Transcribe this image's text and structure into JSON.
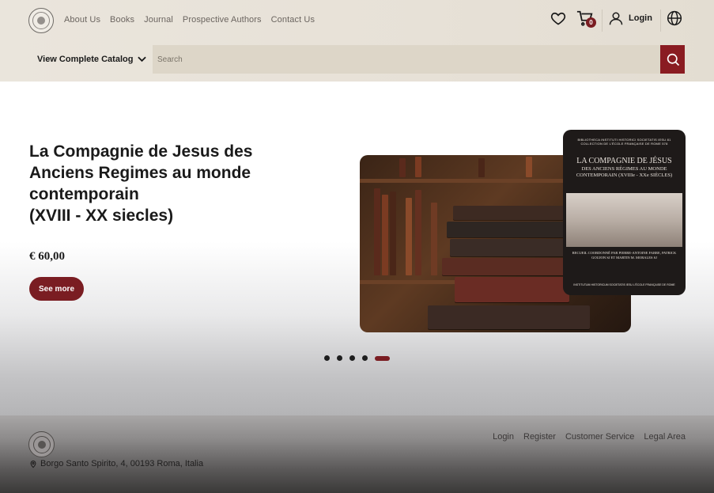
{
  "header": {
    "nav": [
      "About Us",
      "Books",
      "Journal",
      "Prospective Authors",
      "Contact Us"
    ],
    "cart_count": "0",
    "login_label": "Login",
    "catalog_label": "View Complete Catalog",
    "search_placeholder": "Search"
  },
  "hero": {
    "title": "La Compagnie de Jesus des Anciens Regimes au monde contemporain\n(XVIII - XX siecles)",
    "price": "€ 60,00",
    "button_label": "See more",
    "slides": 5,
    "active_slide": 5
  },
  "book_cover": {
    "top_text": "BIBLIOTHECA INSTITUTI HISTORICI SOCIETATIS IESU 81 COLLECTION DE L'ÉCOLE FRANÇAISE DE ROME 578",
    "title": "LA COMPAGNIE DE JÉSUS",
    "subtitle": "DES ANCIENS RÉGIMES AU MONDE CONTEMPORAIN (XVIIIe - XXe SIÈCLES)",
    "credits": "RECUEIL COORDONNÉ PAR PIERRE-ANTOINE FABRE, PATRICK GOUJON SJ ET MARTIN M. MORALES SJ",
    "publisher": "INSTITUTUM HISTORICUM SOCIETATIS IESU L'ÉCOLE FRANÇAISE DE ROME"
  },
  "footer": {
    "links": [
      "Login",
      "Register",
      "Customer Service",
      "Legal Area"
    ],
    "address": "Borgo Santo Spirito, 4, 00193 Roma, Italia"
  },
  "colors": {
    "accent": "#7a1d22",
    "header_bg": "#e8e3da",
    "search_bg": "#ddd6c8"
  }
}
